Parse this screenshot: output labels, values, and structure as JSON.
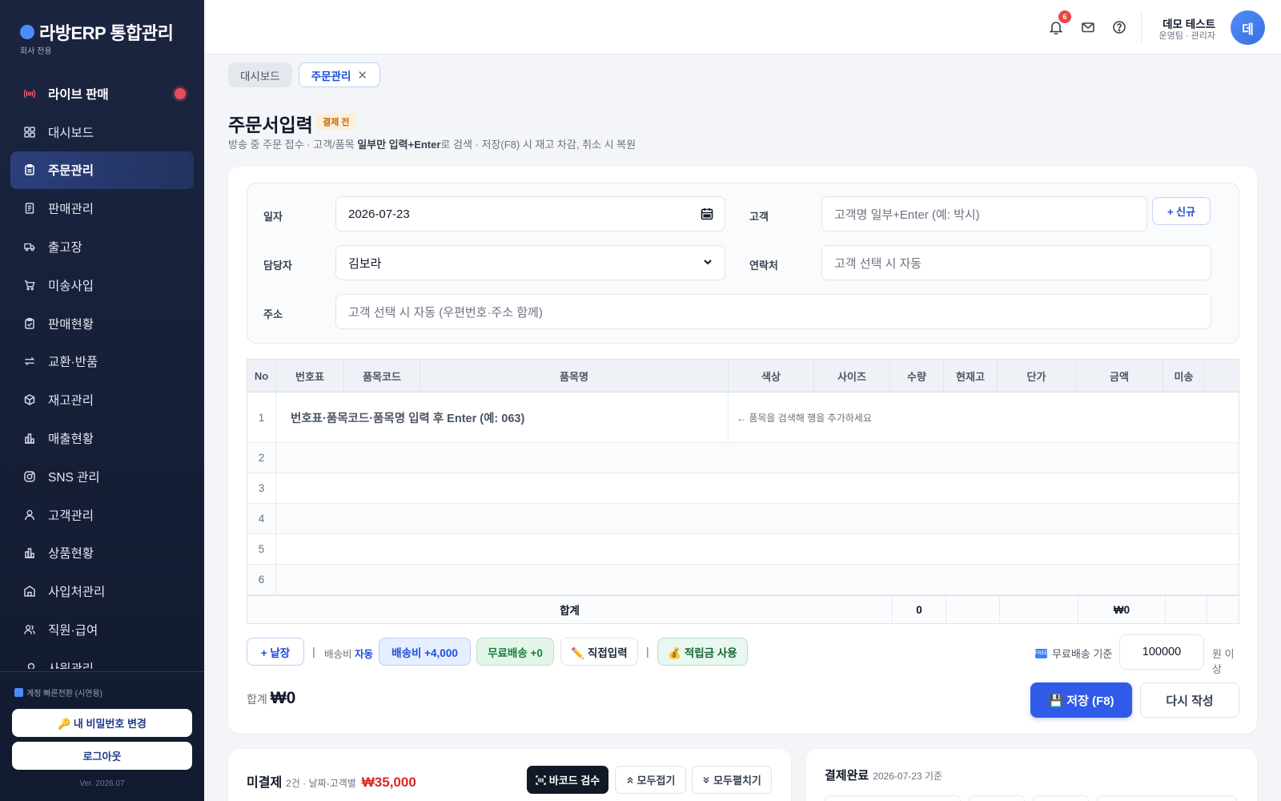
{
  "brand": {
    "title": "라방ERP 통합관리",
    "subtitle": "회사 전용"
  },
  "sidebar": {
    "items": [
      {
        "label": "라이브 판매",
        "icon": "live-broadcast-icon"
      },
      {
        "label": "대시보드",
        "icon": "dashboard-grid-icon"
      },
      {
        "label": "주문관리",
        "icon": "clipboard-icon"
      },
      {
        "label": "판매관리",
        "icon": "receipt-icon"
      },
      {
        "label": "출고장",
        "icon": "truck-icon"
      },
      {
        "label": "미송사입",
        "icon": "cart-icon"
      },
      {
        "label": "판매현황",
        "icon": "clipboard-check-icon"
      },
      {
        "label": "교환·반품",
        "icon": "swap-arrows-icon"
      },
      {
        "label": "재고관리",
        "icon": "box-icon"
      },
      {
        "label": "매출현황",
        "icon": "bar-chart-icon"
      },
      {
        "label": "SNS 관리",
        "icon": "instagram-icon"
      },
      {
        "label": "고객관리",
        "icon": "user-icon"
      },
      {
        "label": "상품현황",
        "icon": "bar-chart-icon"
      },
      {
        "label": "사입처관리",
        "icon": "building-icon"
      },
      {
        "label": "직원·급여",
        "icon": "users-icon"
      },
      {
        "label": "사원관리",
        "icon": "key-icon"
      }
    ],
    "quick_switch": "계정 빠른전환 (시연용)",
    "password_button": "🔑 내 비밀번호 변경",
    "logout_button": "로그아웃",
    "version": "Ver. 2026.07"
  },
  "topbar": {
    "notification_count": "6",
    "user_name": "데모 테스트",
    "user_role": "운영팀 · 관리자",
    "avatar_initial": "데"
  },
  "tabs": [
    {
      "label": "대시보드"
    },
    {
      "label": "주문관리",
      "close": "✕"
    }
  ],
  "page": {
    "title": "주문서입력",
    "status_badge": "결제 전",
    "desc_before": "방송 중 주문 접수 · 고객/품목 ",
    "desc_bold": "일부만 입력+Enter",
    "desc_after": "로 검색 · 저장(F8) 시 재고 차감, 취소 시 복원"
  },
  "form": {
    "date_label": "일자",
    "date_value": "2026-07-23",
    "customer_label": "고객",
    "customer_placeholder": "고객명 일부+Enter (예: 박시)",
    "new_button": "+ 신규",
    "manager_label": "담당자",
    "manager_value": "김보라",
    "contact_label": "연락처",
    "contact_placeholder": "고객 선택 시 자동",
    "address_label": "주소",
    "address_placeholder": "고객 선택 시 자동 (우편번호·주소 함께)"
  },
  "grid": {
    "columns": [
      "No",
      "번호표",
      "품목코드",
      "품목명",
      "색상",
      "사이즈",
      "수량",
      "현재고",
      "단가",
      "금액",
      "미송"
    ],
    "rows": [
      "1",
      "2",
      "3",
      "4",
      "5",
      "6"
    ],
    "search_placeholder": "번호표·품목코드·품목명 입력 후 Enter (예: 063)",
    "hint": "← 품목을 검색해 행을 추가하세요",
    "sum_label": "합계",
    "sum_qty": "0",
    "sum_amount": "₩0"
  },
  "actions": {
    "add_sheet": "+ 낱장",
    "divider": "|",
    "ship_label": "배송비",
    "ship_mode": "자동",
    "ship_fee": "배송비 +4,000",
    "free_ship": "무료배송 +0",
    "manual": "✏️ 직접입력",
    "points": "💰 적립금 사용",
    "free_threshold_label": "무료배송 기준",
    "free_threshold_value": "100000",
    "free_threshold_suffix": "원 이상"
  },
  "footer": {
    "total_label": "합계",
    "total_value": "₩0",
    "save_button": "💾 저장 (F8)",
    "reset_button": "다시 작성"
  },
  "unpaid": {
    "title": "미결제",
    "meta": "2건 · 날짜-고객별",
    "amount": "₩35,000",
    "barcode_button": "바코드 검수",
    "collapse_button": "모두접기",
    "expand_button": "모두펼치기"
  },
  "paid": {
    "title": "결제완료",
    "meta": "2026-07-23 기준"
  },
  "colors": {
    "accent": "#2f5be8",
    "sidebar": "#1b2540",
    "danger": "#dc2626"
  }
}
